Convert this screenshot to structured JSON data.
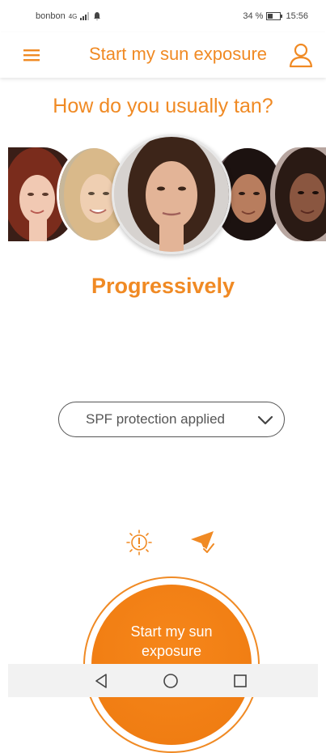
{
  "status_bar": {
    "carrier": "bonbon",
    "network": "4G",
    "battery": "34 %",
    "time": "15:56"
  },
  "app_bar": {
    "title": "Start my sun exposure",
    "menu_icon": "hamburger-menu-icon",
    "profile_icon": "user-profile-icon"
  },
  "question": "How do you usually tan?",
  "faces": [
    {
      "name": "skin-type-1",
      "skin": "#f1c9b3",
      "hair": "#7a2c1c",
      "bg": "#3a1e17"
    },
    {
      "name": "skin-type-2",
      "skin": "#efcfb2",
      "hair": "#d9b98a",
      "bg": "#c7b79a"
    },
    {
      "name": "skin-type-3",
      "skin": "#e3b497",
      "hair": "#3d2519",
      "bg": "#d6d2cf",
      "selected": true
    },
    {
      "name": "skin-type-4",
      "skin": "#b87d5e",
      "hair": "#1c1210",
      "bg": "#6e5d60"
    },
    {
      "name": "skin-type-5",
      "skin": "#8a5640",
      "hair": "#2a1a14",
      "bg": "#b8a6a0"
    }
  ],
  "tan_result": "Progressively",
  "spf_select": {
    "value": "SPF protection applied"
  },
  "actions": {
    "sun_icon": "sun-warning-icon",
    "plane_icon": "paper-plane-check-icon"
  },
  "start_button": {
    "line1": "Start my sun",
    "line2": "exposure"
  },
  "colors": {
    "accent": "#f08a24",
    "button": "#ee7a10"
  }
}
